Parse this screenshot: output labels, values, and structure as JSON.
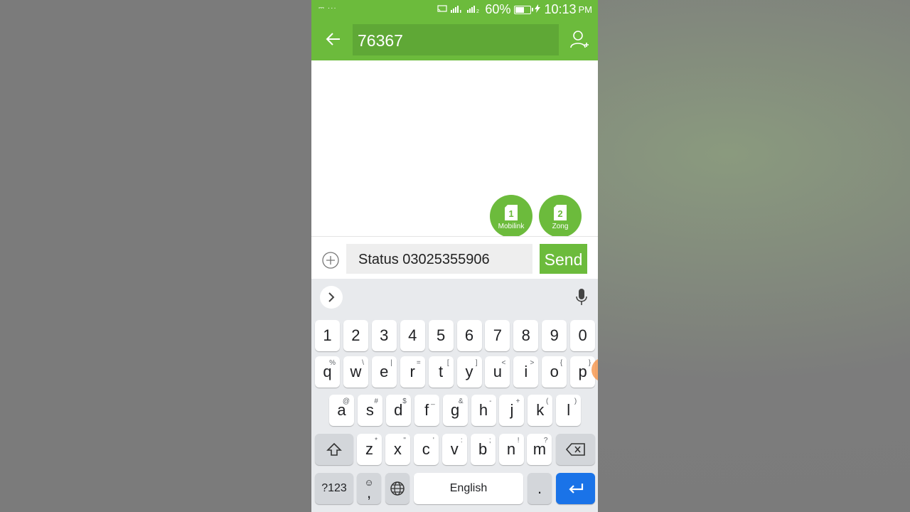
{
  "status_bar": {
    "left_text": "⎓ ···",
    "battery_percent": "60%",
    "battery_level": 0.6,
    "time": "10:13",
    "ampm": "PM"
  },
  "header": {
    "recipient": "76367"
  },
  "sims": [
    {
      "number": "1",
      "label": "Mobilink"
    },
    {
      "number": "2",
      "label": "Zong"
    }
  ],
  "compose": {
    "message": "Status 03025355906",
    "send_label": "Send"
  },
  "keyboard": {
    "number_row": [
      "1",
      "2",
      "3",
      "4",
      "5",
      "6",
      "7",
      "8",
      "9",
      "0"
    ],
    "row1": [
      {
        "k": "q",
        "s": "%"
      },
      {
        "k": "w",
        "s": "\\"
      },
      {
        "k": "e",
        "s": "|"
      },
      {
        "k": "r",
        "s": "="
      },
      {
        "k": "t",
        "s": "["
      },
      {
        "k": "y",
        "s": "]"
      },
      {
        "k": "u",
        "s": "<"
      },
      {
        "k": "i",
        "s": ">"
      },
      {
        "k": "o",
        "s": "{"
      },
      {
        "k": "p",
        "s": "}"
      }
    ],
    "row2": [
      {
        "k": "a",
        "s": "@"
      },
      {
        "k": "s",
        "s": "#"
      },
      {
        "k": "d",
        "s": "$"
      },
      {
        "k": "f",
        "s": "_"
      },
      {
        "k": "g",
        "s": "&"
      },
      {
        "k": "h",
        "s": "-"
      },
      {
        "k": "j",
        "s": "+"
      },
      {
        "k": "k",
        "s": "("
      },
      {
        "k": "l",
        "s": ")"
      }
    ],
    "row3": [
      {
        "k": "z",
        "s": "*"
      },
      {
        "k": "x",
        "s": "\""
      },
      {
        "k": "c",
        "s": "'"
      },
      {
        "k": "v",
        "s": ":"
      },
      {
        "k": "b",
        "s": ";"
      },
      {
        "k": "n",
        "s": "!"
      },
      {
        "k": "m",
        "s": "?"
      }
    ],
    "symbols_label": "?123",
    "comma_label": ",",
    "space_label": "English",
    "period_label": "."
  },
  "colors": {
    "accent": "#6cbb3c",
    "enter_key": "#1a73e8"
  }
}
